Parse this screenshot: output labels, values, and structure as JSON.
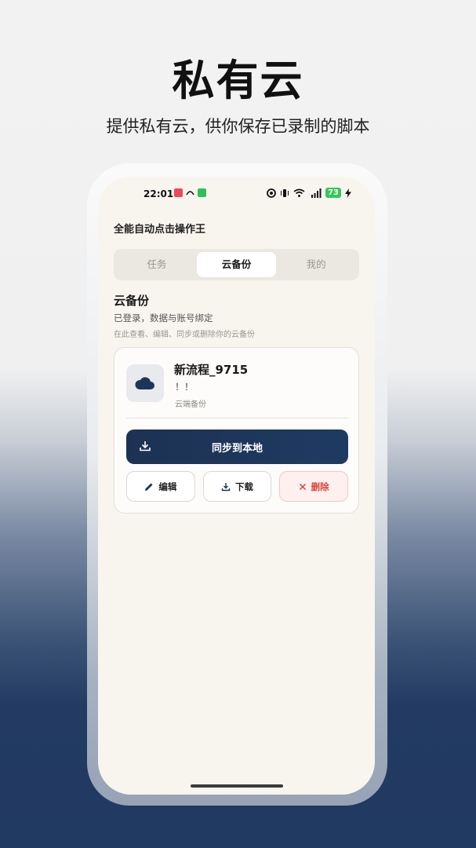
{
  "hero": {
    "title": "私有云",
    "subtitle": "提供私有云，供你保存已录制的脚本"
  },
  "status_bar": {
    "time": "22:01",
    "battery": "73"
  },
  "app": {
    "title": "全能自动点击操作王"
  },
  "tabs": [
    {
      "label": "任务",
      "active": false
    },
    {
      "label": "云备份",
      "active": true
    },
    {
      "label": "我的",
      "active": false
    }
  ],
  "section": {
    "title": "云备份",
    "subtitle": "已登录，数据与账号绑定",
    "hint": "在此查看、编辑、同步或删除你的云备份"
  },
  "card": {
    "icon": "cloud-icon",
    "name": "新流程_9715",
    "desc": "！！",
    "source": "云端备份",
    "sync_label": "同步到本地",
    "edit_label": "编辑",
    "download_label": "下载",
    "delete_label": "删除"
  },
  "colors": {
    "accent": "#1e355a",
    "danger": "#d9453e",
    "screen_bg": "#f8f5ef"
  }
}
